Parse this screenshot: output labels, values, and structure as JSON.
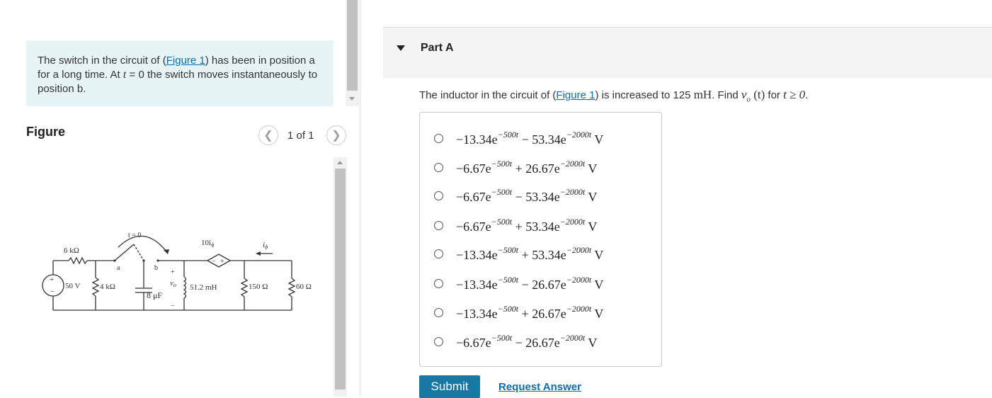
{
  "intro": {
    "text_before": "The switch in the circuit of (",
    "figure_link": "Figure 1",
    "text_after_1": ") has been in position a for a long time. At ",
    "t_var": "t",
    "text_after_2": " = 0 the switch moves instantaneously to position b."
  },
  "figure": {
    "label": "Figure",
    "pager": "1 of 1",
    "prev_icon": "chevron-left-icon",
    "next_icon": "chevron-right-icon"
  },
  "circuit": {
    "source_label": "50 V",
    "r1_label": "6 kΩ",
    "r2_label": "4 kΩ",
    "switch_label": "t = 0",
    "pos_a": "a",
    "pos_b": "b",
    "cap_label": "8 μF",
    "vo_label": "v",
    "vo_sub": "o",
    "dep_source_label": "10i",
    "dep_source_sub": "ϕ",
    "inductor_label": "51.2 mH",
    "r3_label": "150 Ω",
    "r4_label": "60 Ω",
    "current_label": "i",
    "current_sub": "ϕ",
    "plus": "+",
    "minus": "−"
  },
  "part": {
    "title": "Part A",
    "collapse_icon": "caret-down-icon"
  },
  "question": {
    "text_before": "The inductor in the circuit of (",
    "figure_link": "Figure 1",
    "text_middle": ") is increased to 125 ",
    "unit": "mH",
    "text_find": ". Find ",
    "func": "v",
    "func_sub": "o",
    "func_arg": "(t)",
    "text_for": " for ",
    "condition": "t ≥ 0",
    "text_end": "."
  },
  "options": [
    {
      "c1": "−13.34e",
      "e1": "−500t",
      "op": "−",
      "c2": "53.34e",
      "e2": "−2000t",
      "unit": "V"
    },
    {
      "c1": "−6.67e",
      "e1": "−500t",
      "op": "+",
      "c2": "26.67e",
      "e2": "−2000t",
      "unit": "V"
    },
    {
      "c1": "−6.67e",
      "e1": "−500t",
      "op": "−",
      "c2": "53.34e",
      "e2": "−2000t",
      "unit": "V"
    },
    {
      "c1": "−6.67e",
      "e1": "−500t",
      "op": "+",
      "c2": "53.34e",
      "e2": "−2000t",
      "unit": "V"
    },
    {
      "c1": "−13.34e",
      "e1": "−500t",
      "op": "+",
      "c2": "53.34e",
      "e2": "−2000t",
      "unit": "V"
    },
    {
      "c1": "−13.34e",
      "e1": "−500t",
      "op": "−",
      "c2": "26.67e",
      "e2": "−2000t",
      "unit": "V"
    },
    {
      "c1": "−13.34e",
      "e1": "−500t",
      "op": "+",
      "c2": "26.67e",
      "e2": "−2000t",
      "unit": "V"
    },
    {
      "c1": "−6.67e",
      "e1": "−500t",
      "op": "−",
      "c2": "26.67e",
      "e2": "−2000t",
      "unit": "V"
    }
  ],
  "actions": {
    "submit": "Submit",
    "request_answer": "Request Answer"
  }
}
